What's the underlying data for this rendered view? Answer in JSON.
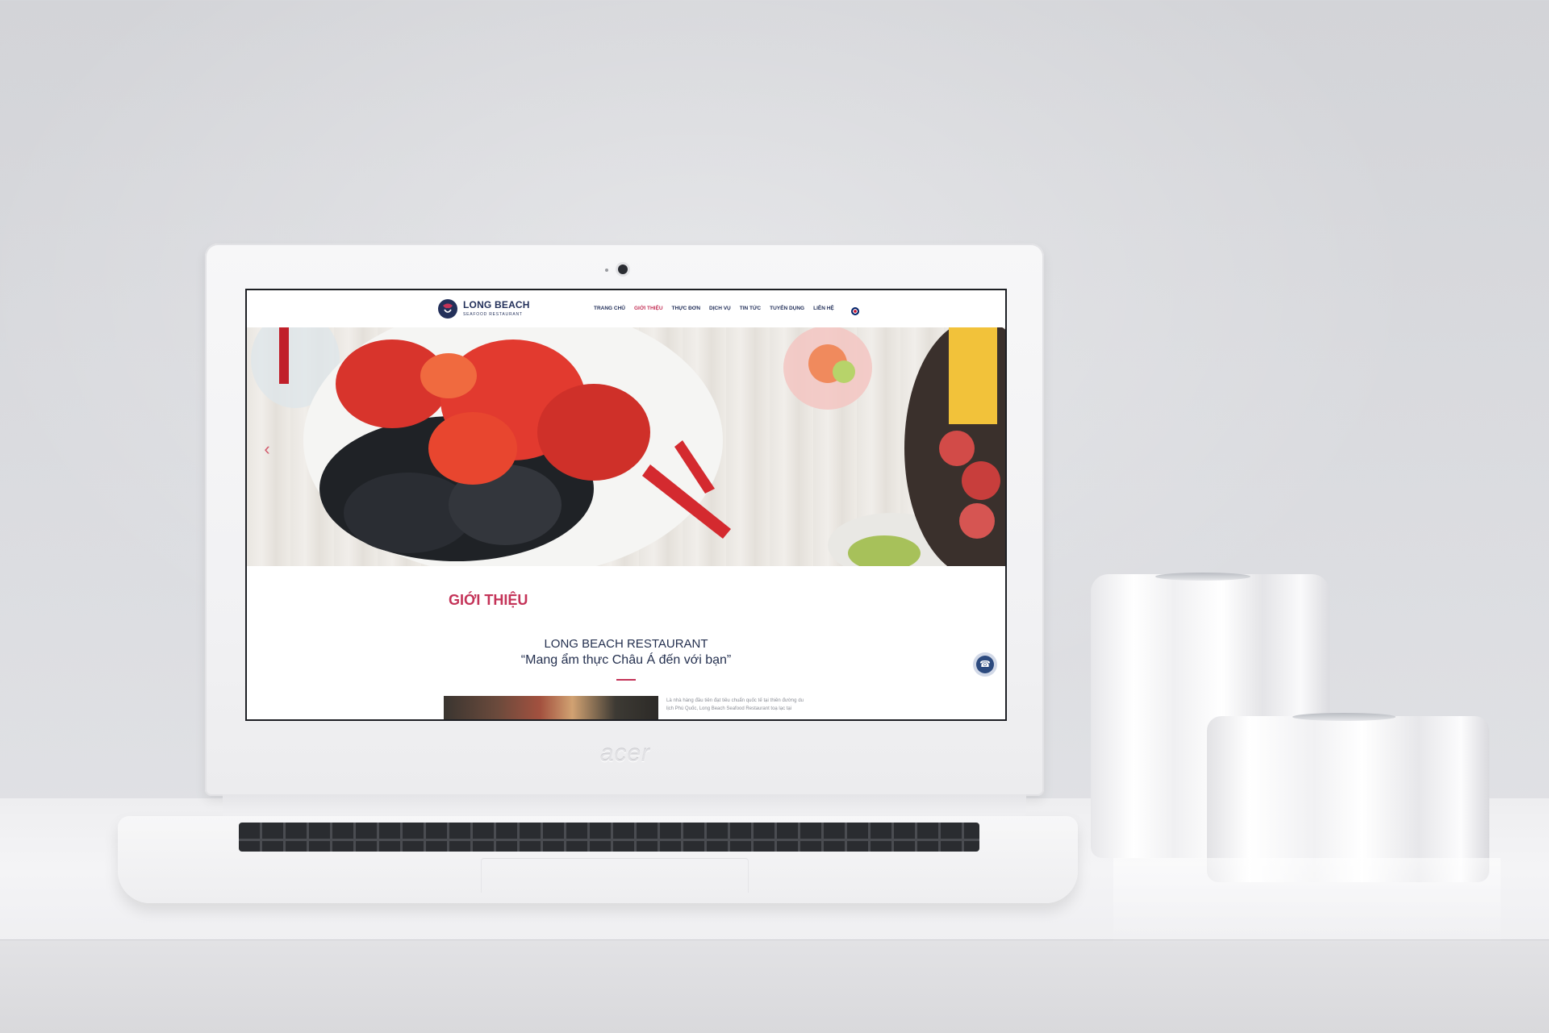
{
  "laptop": {
    "brand": "acer"
  },
  "site": {
    "logo": {
      "name": "LONG BEACH",
      "tagline": "SEAFOOD RESTAURANT"
    },
    "nav": [
      {
        "label": "TRANG CHỦ",
        "active": false
      },
      {
        "label": "GIỚI THIỆU",
        "active": true
      },
      {
        "label": "THỰC ĐƠN",
        "active": false
      },
      {
        "label": "DỊCH VỤ",
        "active": false
      },
      {
        "label": "TIN TỨC",
        "active": false
      },
      {
        "label": "TUYỂN DỤNG",
        "active": false
      },
      {
        "label": "LIÊN HỆ",
        "active": false
      }
    ],
    "language_icon": "uk-flag-icon",
    "hero": {
      "prev_icon": "chevron-left-icon"
    },
    "about": {
      "section_title": "GIỚI THIỆU",
      "restaurant_name": "LONG BEACH RESTAURANT",
      "slogan": "“Mang ẩm thực Châu Á đến với bạn”",
      "text": "Là nhà hàng đầu tiên đạt tiêu chuẩn quốc tế tại thiên đường du lịch Phú Quốc, Long Beach Seafood Restaurant toạ lạc tại"
    },
    "call_icon": "phone-icon",
    "colors": {
      "accent": "#c43358",
      "navy": "#23305a"
    }
  }
}
